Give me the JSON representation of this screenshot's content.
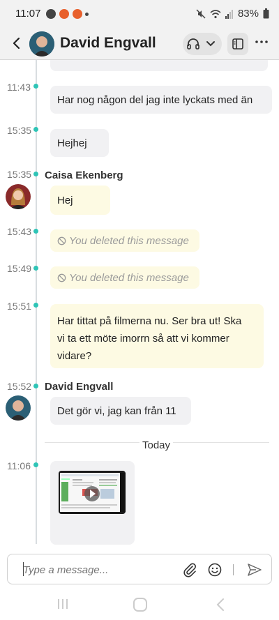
{
  "status_bar": {
    "time": "11:07",
    "battery": "83%",
    "icons": [
      "mute-icon",
      "wifi-icon",
      "signal-icon",
      "battery-icon"
    ]
  },
  "header": {
    "contact_name": "David Engvall",
    "icons": [
      "back-icon",
      "headphones-icon",
      "chevron-down-icon",
      "side-panel-icon",
      "more-icon"
    ]
  },
  "messages": [
    {
      "time": "11:43",
      "text": "Har nog någon del jag inte lyckats med än"
    },
    {
      "time": "15:35",
      "text": "Hejhej"
    },
    {
      "time": "15:35",
      "sender": "Caisa Ekenberg",
      "text": "Hej"
    },
    {
      "time": "15:43",
      "text": "You deleted this message"
    },
    {
      "time": "15:49",
      "text": "You deleted this message"
    },
    {
      "time": "15:51",
      "text_lines": [
        "Har tittat på filmerna nu. Ser bra ut! Ska",
        "vi ta ett möte imorrn så att vi kommer",
        "vidare?"
      ]
    },
    {
      "time": "15:52",
      "sender": "David Engvall",
      "text": "Det gör vi, jag kan från 11"
    },
    {
      "time": "11:06",
      "attachment": "video"
    }
  ],
  "divider": "Today",
  "composer": {
    "placeholder": "Type a message...",
    "icons": [
      "attach-icon",
      "emoji-icon",
      "send-icon"
    ]
  },
  "colors": {
    "timeline_dot": "#2ec4b6",
    "own_bubble": "#fdfae3",
    "other_bubble": "#f1f1f3"
  }
}
